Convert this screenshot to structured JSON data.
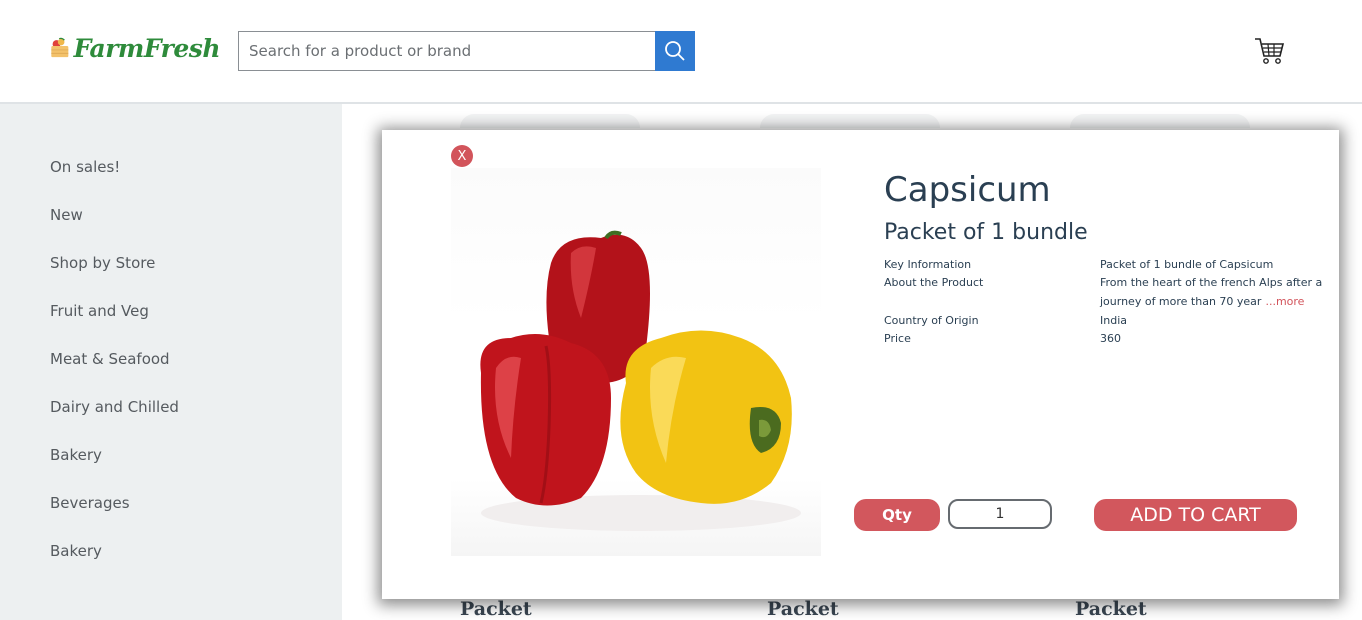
{
  "header": {
    "brand": "FarmFresh",
    "search": {
      "placeholder": "Search for a product or brand",
      "value": ""
    },
    "cart_icon": "cart-icon",
    "search_icon": "search-icon"
  },
  "sidebar": {
    "items": [
      {
        "label": "On sales!"
      },
      {
        "label": "New"
      },
      {
        "label": "Shop by Store"
      },
      {
        "label": "Fruit and Veg"
      },
      {
        "label": "Meat & Seafood"
      },
      {
        "label": "Dairy and Chilled"
      },
      {
        "label": "Bakery"
      },
      {
        "label": "Beverages"
      },
      {
        "label": "Bakery"
      }
    ]
  },
  "background_cards": [
    {
      "label": "Packet"
    },
    {
      "label": "Packet"
    },
    {
      "label": "Packet"
    }
  ],
  "modal": {
    "close_label": "X",
    "title": "Capsicum",
    "subtitle": "Packet of 1 bundle",
    "info": {
      "key_information_label": "Key Information",
      "key_information_value": "Packet of 1 bundle of Capsicum",
      "about_label": "About the Product",
      "about_value": "From the heart of the french Alps after a journey of more than 70 year",
      "more_link": "...more",
      "origin_label": "Country of Origin",
      "origin_value": "India",
      "price_label": "Price",
      "price_value": "360"
    },
    "qty_label": "Qty",
    "qty_value": "1",
    "add_to_cart_label": "ADD TO CART"
  },
  "colors": {
    "accent": "#d2575d",
    "search_button": "#2f7ad1",
    "brand_green": "#2e8b3b",
    "sidebar_bg": "#edf0f1",
    "text_dark": "#2a3f52"
  }
}
